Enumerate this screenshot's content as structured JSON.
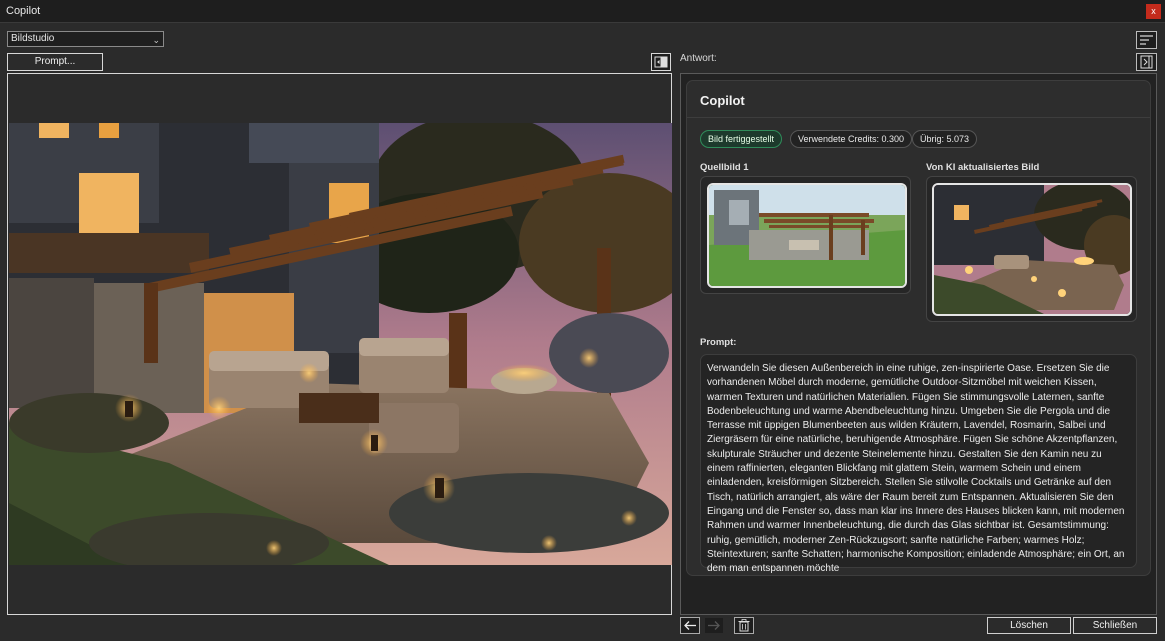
{
  "window": {
    "title": "Copilot",
    "close_label": "x"
  },
  "toolbar": {
    "mode_select_value": "Bildstudio",
    "prompt_button": "Prompt..."
  },
  "answer": {
    "label": "Antwort:",
    "card_title": "Copilot",
    "status_badge": "Bild fertiggestellt",
    "credits_used": "Verwendete Credits: 0.300",
    "credits_remaining": "Übrig: 5.073",
    "source_label": "Quellbild 1",
    "ai_label": "Von KI aktualisiertes Bild",
    "prompt_label": "Prompt:",
    "prompt_text": "Verwandeln Sie diesen Außenbereich in eine ruhige, zen-inspirierte Oase. Ersetzen Sie die vorhandenen Möbel durch moderne, gemütliche Outdoor-Sitzmöbel mit weichen Kissen, warmen Texturen und natürlichen Materialien. Fügen Sie stimmungsvolle Laternen, sanfte Bodenbeleuchtung und warme Abendbeleuchtung hinzu. Umgeben Sie die Pergola und die Terrasse mit üppigen Blumenbeeten aus wilden Kräutern, Lavendel, Rosmarin, Salbei und Ziergräsern für eine natürliche, beruhigende Atmosphäre. Fügen Sie schöne Akzentpflanzen, skulpturale Sträucher und dezente Steinelemente hinzu. Gestalten Sie den Kamin neu zu einem raffinierten, eleganten Blickfang mit glattem Stein, warmem Schein und einem einladenden, kreisförmigen Sitzbereich. Stellen Sie stilvolle Cocktails und Getränke auf den Tisch, natürlich arrangiert, als wäre der Raum bereit zum Entspannen. Aktualisieren Sie den Eingang und die Fenster so, dass man klar ins Innere des Hauses blicken kann, mit modernen Rahmen und warmer Innenbeleuchtung, die durch das Glas sichtbar ist. Gesamtstimmung: ruhig, gemütlich, moderner Zen-Rückzugsort; sanfte natürliche Farben; warmes Holz; Steintexturen; sanfte Schatten; harmonische Komposition; einladende Atmosphäre; ein Ort, an dem man entspannen möchte"
  },
  "footer": {
    "delete_button": "Löschen",
    "close_button": "Schließen"
  },
  "icons": {
    "back": "arrow-left-icon",
    "forward": "arrow-right-icon",
    "trash": "trash-icon",
    "menu": "menu-icon",
    "panel": "panel-collapse-icon",
    "swap": "swap-icon"
  },
  "colors": {
    "success_badge": "#2f8c5a",
    "close_red": "#c42b1c"
  }
}
